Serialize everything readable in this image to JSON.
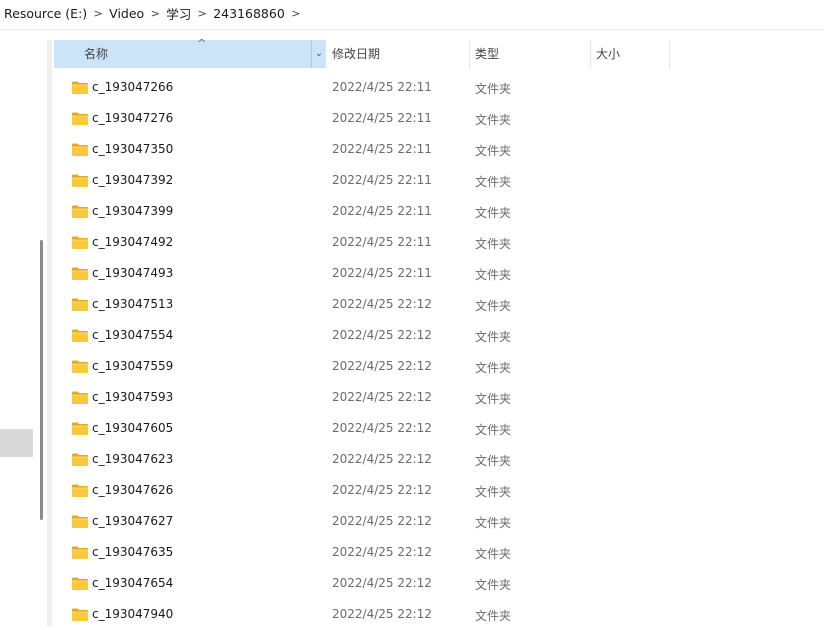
{
  "breadcrumb": [
    "Resource (E:)",
    "Video",
    "学习",
    "243168860"
  ],
  "columns": {
    "name": "名称",
    "date": "修改日期",
    "type": "类型",
    "size": "大小"
  },
  "rows": [
    {
      "name": "c_193047266",
      "date": "2022/4/25 22:11",
      "type": "文件夹"
    },
    {
      "name": "c_193047276",
      "date": "2022/4/25 22:11",
      "type": "文件夹"
    },
    {
      "name": "c_193047350",
      "date": "2022/4/25 22:11",
      "type": "文件夹"
    },
    {
      "name": "c_193047392",
      "date": "2022/4/25 22:11",
      "type": "文件夹"
    },
    {
      "name": "c_193047399",
      "date": "2022/4/25 22:11",
      "type": "文件夹"
    },
    {
      "name": "c_193047492",
      "date": "2022/4/25 22:11",
      "type": "文件夹"
    },
    {
      "name": "c_193047493",
      "date": "2022/4/25 22:11",
      "type": "文件夹"
    },
    {
      "name": "c_193047513",
      "date": "2022/4/25 22:12",
      "type": "文件夹"
    },
    {
      "name": "c_193047554",
      "date": "2022/4/25 22:12",
      "type": "文件夹"
    },
    {
      "name": "c_193047559",
      "date": "2022/4/25 22:12",
      "type": "文件夹"
    },
    {
      "name": "c_193047593",
      "date": "2022/4/25 22:12",
      "type": "文件夹"
    },
    {
      "name": "c_193047605",
      "date": "2022/4/25 22:12",
      "type": "文件夹"
    },
    {
      "name": "c_193047623",
      "date": "2022/4/25 22:12",
      "type": "文件夹"
    },
    {
      "name": "c_193047626",
      "date": "2022/4/25 22:12",
      "type": "文件夹"
    },
    {
      "name": "c_193047627",
      "date": "2022/4/25 22:12",
      "type": "文件夹"
    },
    {
      "name": "c_193047635",
      "date": "2022/4/25 22:12",
      "type": "文件夹"
    },
    {
      "name": "c_193047654",
      "date": "2022/4/25 22:12",
      "type": "文件夹"
    },
    {
      "name": "c_193047940",
      "date": "2022/4/25 22:12",
      "type": "文件夹"
    }
  ],
  "icons": {
    "folder": "folder-icon",
    "separator": "chevron-right-icon",
    "sort": "sort-up-icon",
    "column_menu": "chevron-down-icon"
  },
  "colors": {
    "header_selected": "#cce4f7",
    "folder_body": "#f8c93e",
    "folder_tab": "#e5a91e",
    "nav_selected": "#d9d9d9"
  }
}
